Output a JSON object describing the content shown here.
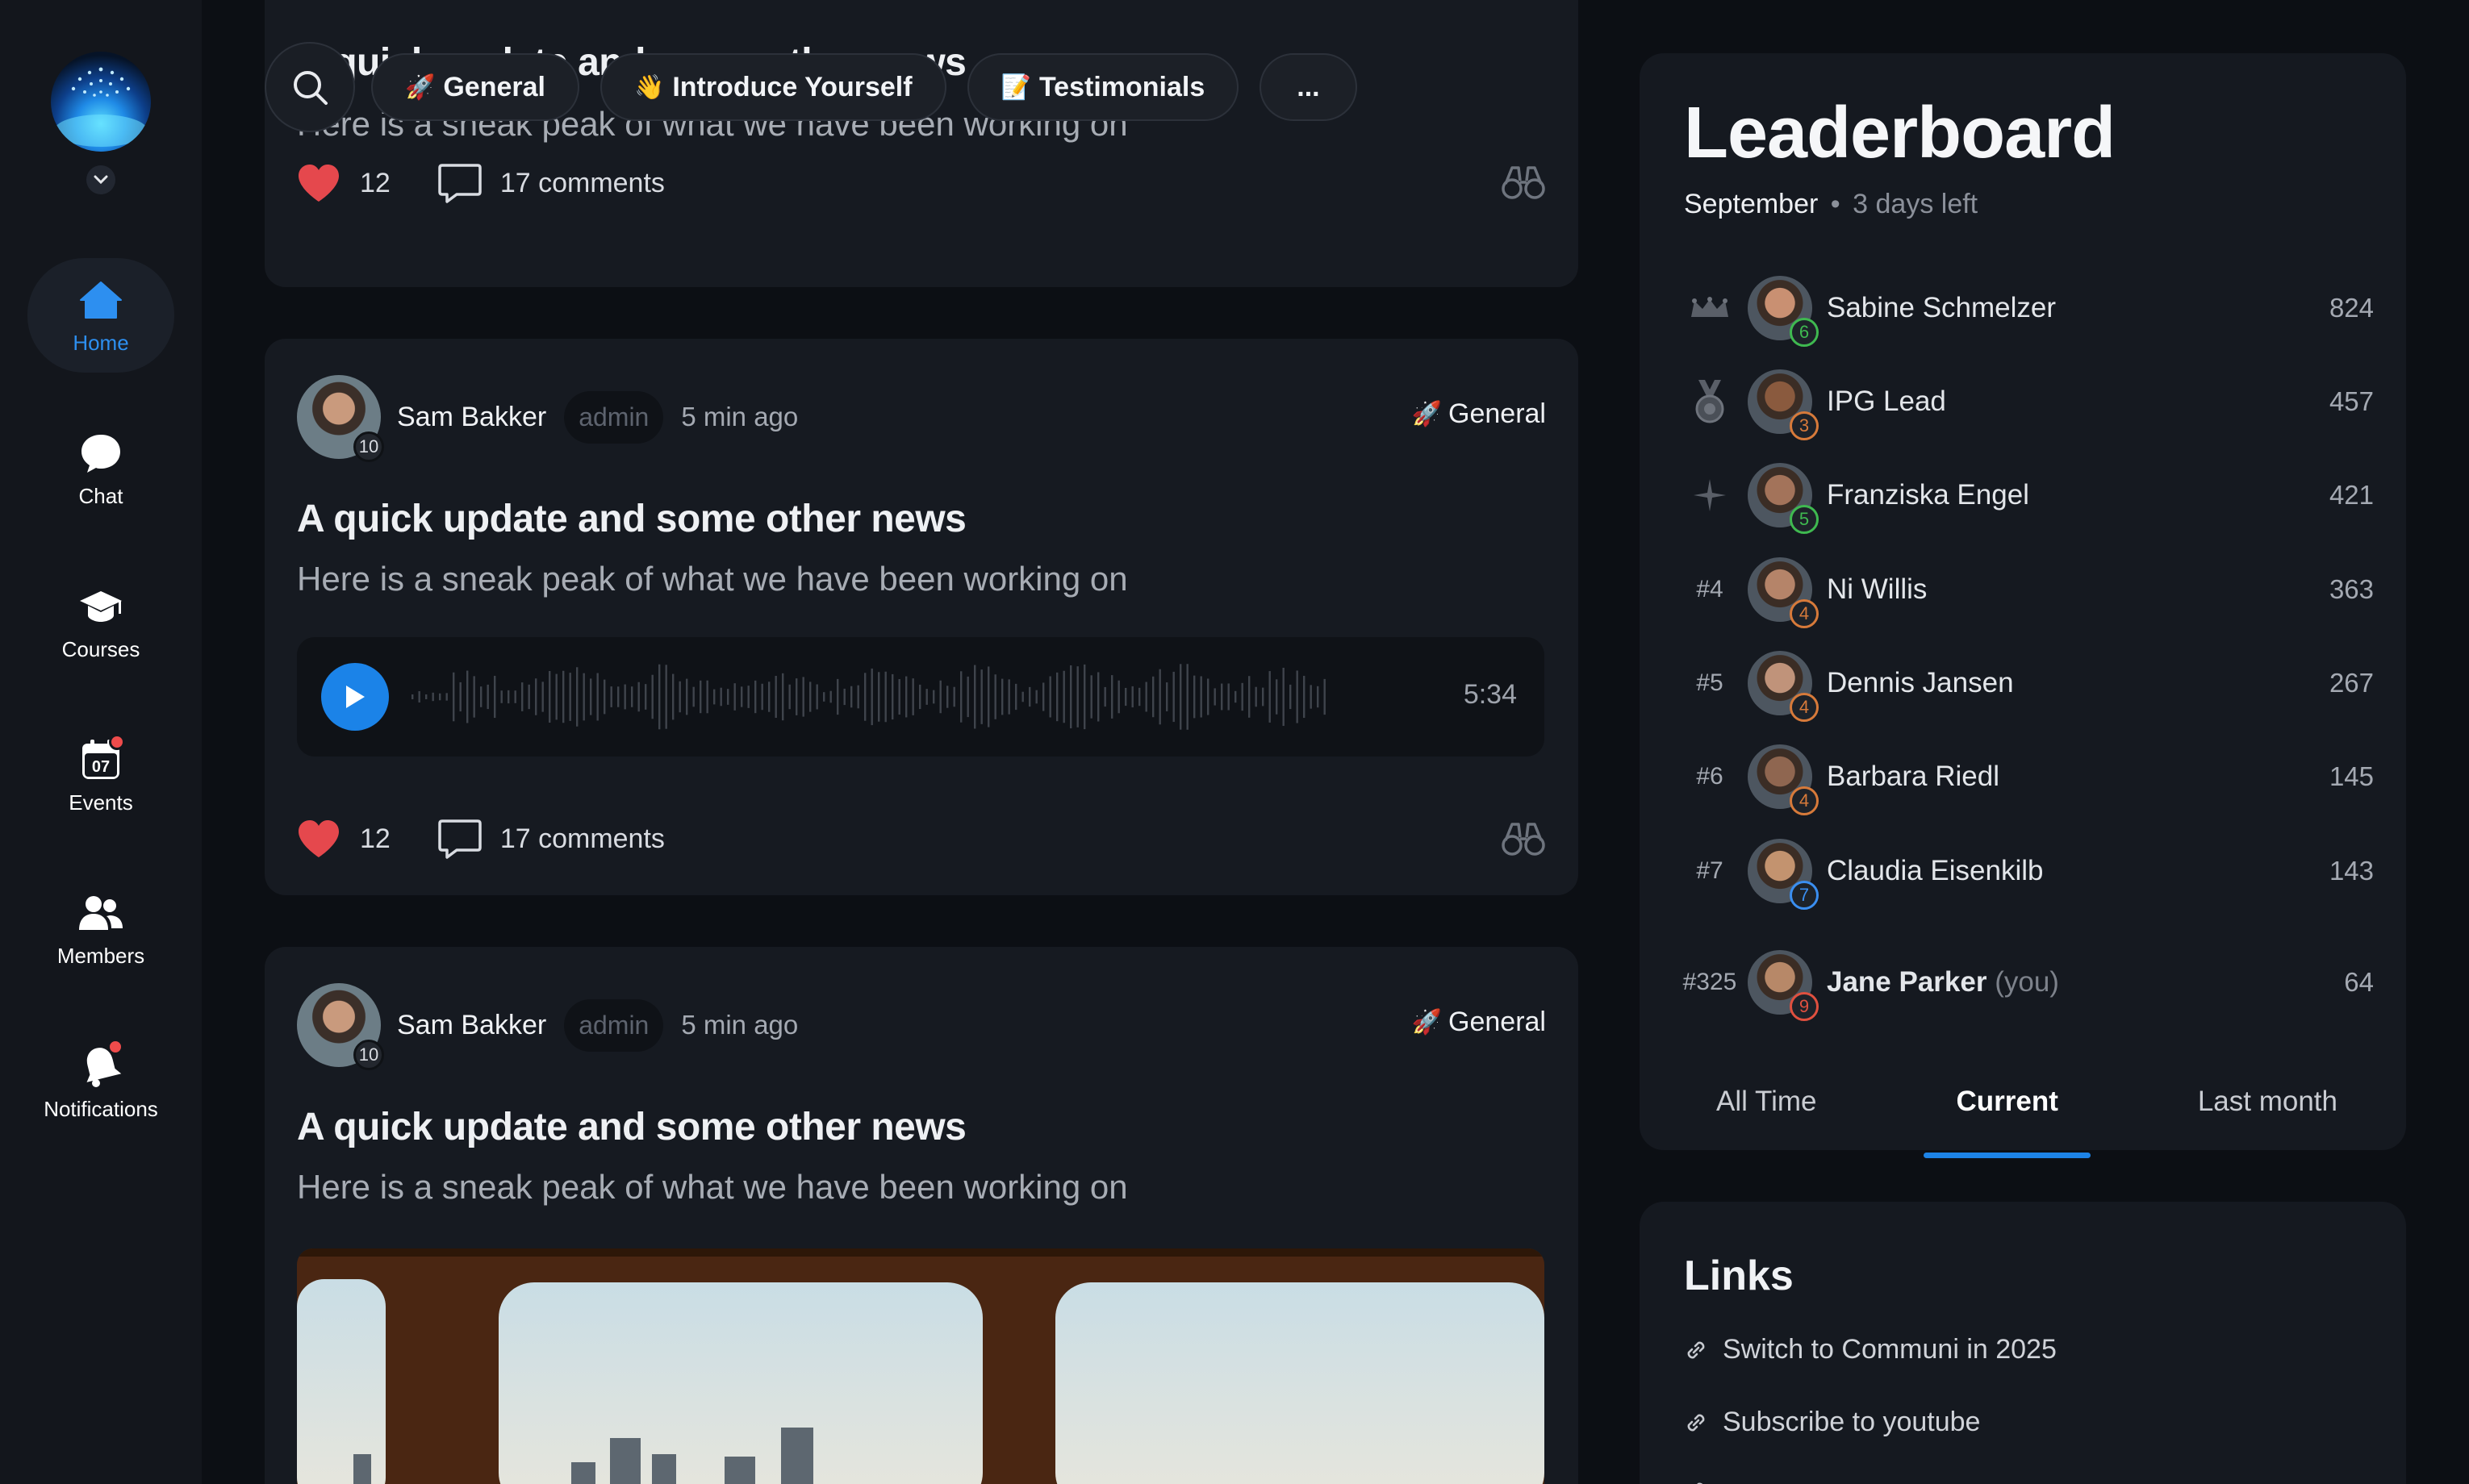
{
  "sidebar": {
    "items": [
      {
        "label": "Home",
        "icon": "home-icon",
        "active": true
      },
      {
        "label": "Chat",
        "icon": "chat-icon"
      },
      {
        "label": "Courses",
        "icon": "graduation-cap-icon"
      },
      {
        "label": "Events",
        "icon": "calendar-icon",
        "date": "07",
        "badge": true
      },
      {
        "label": "Members",
        "icon": "members-icon"
      },
      {
        "label": "Notifications",
        "icon": "bell-icon",
        "badge": true
      }
    ]
  },
  "filters": {
    "chips": [
      {
        "emoji": "🚀",
        "label": "General"
      },
      {
        "emoji": "👋",
        "label": "Introduce Yourself"
      },
      {
        "emoji": "📝",
        "label": "Testimonials"
      }
    ],
    "more": "..."
  },
  "posts": [
    {
      "title": "A quick update and some other news",
      "subtitle": "Here is a sneak peak of what we have been working on",
      "likes": "12",
      "comments": "17 comments"
    },
    {
      "author": "Sam Bakker",
      "author_level": "10",
      "role": "admin",
      "time": "5 min ago",
      "category_emoji": "🚀",
      "category": "General",
      "title": "A quick update and some other news",
      "subtitle": "Here is a sneak peak of what we have been working on",
      "audio_duration": "5:34",
      "likes": "12",
      "comments": "17 comments"
    },
    {
      "author": "Sam Bakker",
      "author_level": "10",
      "role": "admin",
      "time": "5 min ago",
      "category_emoji": "🚀",
      "category": "General",
      "title": "A quick update and some other news",
      "subtitle": "Here is a sneak peak of what we have been working on"
    }
  ],
  "leaderboard": {
    "title": "Leaderboard",
    "month": "September",
    "separator": "•",
    "remaining": "3 days left",
    "rows": [
      {
        "rank": "",
        "rank_icon": "crown-icon",
        "name": "Sabine Schmelzer",
        "level": "6",
        "level_color": "#3fb950",
        "points": "824"
      },
      {
        "rank": "",
        "rank_icon": "medal-icon",
        "name": "IPG Lead",
        "level": "3",
        "level_color": "#d77a3a",
        "points": "457"
      },
      {
        "rank": "",
        "rank_icon": "star-icon",
        "name": "Franziska Engel",
        "level": "5",
        "level_color": "#3fb950",
        "points": "421"
      },
      {
        "rank": "#4",
        "name": "Ni Willis",
        "level": "4",
        "level_color": "#d77a3a",
        "points": "363"
      },
      {
        "rank": "#5",
        "name": "Dennis Jansen",
        "level": "4",
        "level_color": "#d77a3a",
        "points": "267"
      },
      {
        "rank": "#6",
        "name": "Barbara Riedl",
        "level": "4",
        "level_color": "#d77a3a",
        "points": "145"
      },
      {
        "rank": "#7",
        "name": "Claudia Eisenkilb",
        "level": "7",
        "level_color": "#3a8ef0",
        "points": "143"
      },
      {
        "rank": "#325",
        "name": "Jane Parker",
        "you_suffix": "(you)",
        "level": "9",
        "level_color": "#e0503f",
        "points": "64"
      }
    ],
    "tabs": [
      "All Time",
      "Current",
      "Last month"
    ],
    "active_tab": "Current"
  },
  "links": {
    "title": "Links",
    "items": [
      "Switch to Communi in 2025",
      "Subscribe to youtube"
    ]
  },
  "colors": {
    "accent": "#1d83e6",
    "like": "#e5484d",
    "background": "#0c0f14",
    "card": "#161a21"
  }
}
